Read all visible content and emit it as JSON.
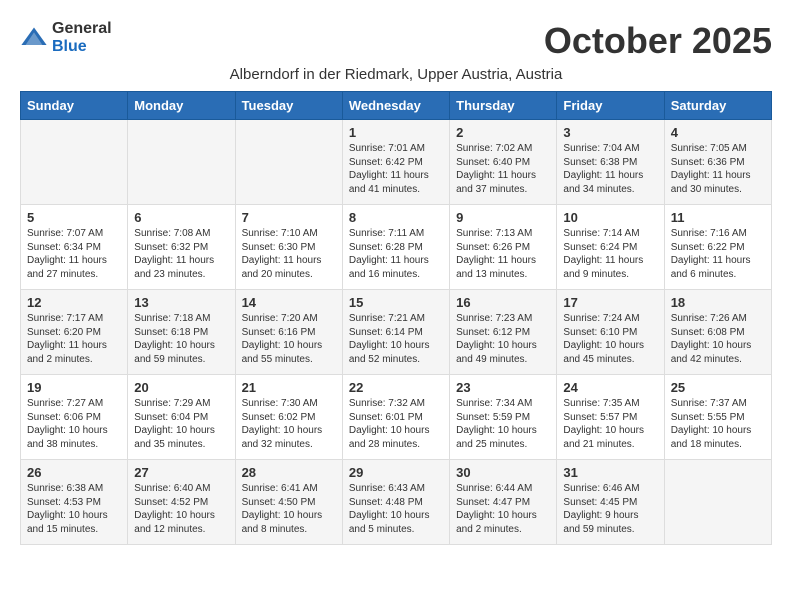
{
  "logo": {
    "general": "General",
    "blue": "Blue"
  },
  "title": "October 2025",
  "subtitle": "Alberndorf in der Riedmark, Upper Austria, Austria",
  "days_of_week": [
    "Sunday",
    "Monday",
    "Tuesday",
    "Wednesday",
    "Thursday",
    "Friday",
    "Saturday"
  ],
  "weeks": [
    [
      {
        "day": "",
        "info": ""
      },
      {
        "day": "",
        "info": ""
      },
      {
        "day": "",
        "info": ""
      },
      {
        "day": "1",
        "info": "Sunrise: 7:01 AM\nSunset: 6:42 PM\nDaylight: 11 hours and 41 minutes."
      },
      {
        "day": "2",
        "info": "Sunrise: 7:02 AM\nSunset: 6:40 PM\nDaylight: 11 hours and 37 minutes."
      },
      {
        "day": "3",
        "info": "Sunrise: 7:04 AM\nSunset: 6:38 PM\nDaylight: 11 hours and 34 minutes."
      },
      {
        "day": "4",
        "info": "Sunrise: 7:05 AM\nSunset: 6:36 PM\nDaylight: 11 hours and 30 minutes."
      }
    ],
    [
      {
        "day": "5",
        "info": "Sunrise: 7:07 AM\nSunset: 6:34 PM\nDaylight: 11 hours and 27 minutes."
      },
      {
        "day": "6",
        "info": "Sunrise: 7:08 AM\nSunset: 6:32 PM\nDaylight: 11 hours and 23 minutes."
      },
      {
        "day": "7",
        "info": "Sunrise: 7:10 AM\nSunset: 6:30 PM\nDaylight: 11 hours and 20 minutes."
      },
      {
        "day": "8",
        "info": "Sunrise: 7:11 AM\nSunset: 6:28 PM\nDaylight: 11 hours and 16 minutes."
      },
      {
        "day": "9",
        "info": "Sunrise: 7:13 AM\nSunset: 6:26 PM\nDaylight: 11 hours and 13 minutes."
      },
      {
        "day": "10",
        "info": "Sunrise: 7:14 AM\nSunset: 6:24 PM\nDaylight: 11 hours and 9 minutes."
      },
      {
        "day": "11",
        "info": "Sunrise: 7:16 AM\nSunset: 6:22 PM\nDaylight: 11 hours and 6 minutes."
      }
    ],
    [
      {
        "day": "12",
        "info": "Sunrise: 7:17 AM\nSunset: 6:20 PM\nDaylight: 11 hours and 2 minutes."
      },
      {
        "day": "13",
        "info": "Sunrise: 7:18 AM\nSunset: 6:18 PM\nDaylight: 10 hours and 59 minutes."
      },
      {
        "day": "14",
        "info": "Sunrise: 7:20 AM\nSunset: 6:16 PM\nDaylight: 10 hours and 55 minutes."
      },
      {
        "day": "15",
        "info": "Sunrise: 7:21 AM\nSunset: 6:14 PM\nDaylight: 10 hours and 52 minutes."
      },
      {
        "day": "16",
        "info": "Sunrise: 7:23 AM\nSunset: 6:12 PM\nDaylight: 10 hours and 49 minutes."
      },
      {
        "day": "17",
        "info": "Sunrise: 7:24 AM\nSunset: 6:10 PM\nDaylight: 10 hours and 45 minutes."
      },
      {
        "day": "18",
        "info": "Sunrise: 7:26 AM\nSunset: 6:08 PM\nDaylight: 10 hours and 42 minutes."
      }
    ],
    [
      {
        "day": "19",
        "info": "Sunrise: 7:27 AM\nSunset: 6:06 PM\nDaylight: 10 hours and 38 minutes."
      },
      {
        "day": "20",
        "info": "Sunrise: 7:29 AM\nSunset: 6:04 PM\nDaylight: 10 hours and 35 minutes."
      },
      {
        "day": "21",
        "info": "Sunrise: 7:30 AM\nSunset: 6:02 PM\nDaylight: 10 hours and 32 minutes."
      },
      {
        "day": "22",
        "info": "Sunrise: 7:32 AM\nSunset: 6:01 PM\nDaylight: 10 hours and 28 minutes."
      },
      {
        "day": "23",
        "info": "Sunrise: 7:34 AM\nSunset: 5:59 PM\nDaylight: 10 hours and 25 minutes."
      },
      {
        "day": "24",
        "info": "Sunrise: 7:35 AM\nSunset: 5:57 PM\nDaylight: 10 hours and 21 minutes."
      },
      {
        "day": "25",
        "info": "Sunrise: 7:37 AM\nSunset: 5:55 PM\nDaylight: 10 hours and 18 minutes."
      }
    ],
    [
      {
        "day": "26",
        "info": "Sunrise: 6:38 AM\nSunset: 4:53 PM\nDaylight: 10 hours and 15 minutes."
      },
      {
        "day": "27",
        "info": "Sunrise: 6:40 AM\nSunset: 4:52 PM\nDaylight: 10 hours and 12 minutes."
      },
      {
        "day": "28",
        "info": "Sunrise: 6:41 AM\nSunset: 4:50 PM\nDaylight: 10 hours and 8 minutes."
      },
      {
        "day": "29",
        "info": "Sunrise: 6:43 AM\nSunset: 4:48 PM\nDaylight: 10 hours and 5 minutes."
      },
      {
        "day": "30",
        "info": "Sunrise: 6:44 AM\nSunset: 4:47 PM\nDaylight: 10 hours and 2 minutes."
      },
      {
        "day": "31",
        "info": "Sunrise: 6:46 AM\nSunset: 4:45 PM\nDaylight: 9 hours and 59 minutes."
      },
      {
        "day": "",
        "info": ""
      }
    ]
  ]
}
